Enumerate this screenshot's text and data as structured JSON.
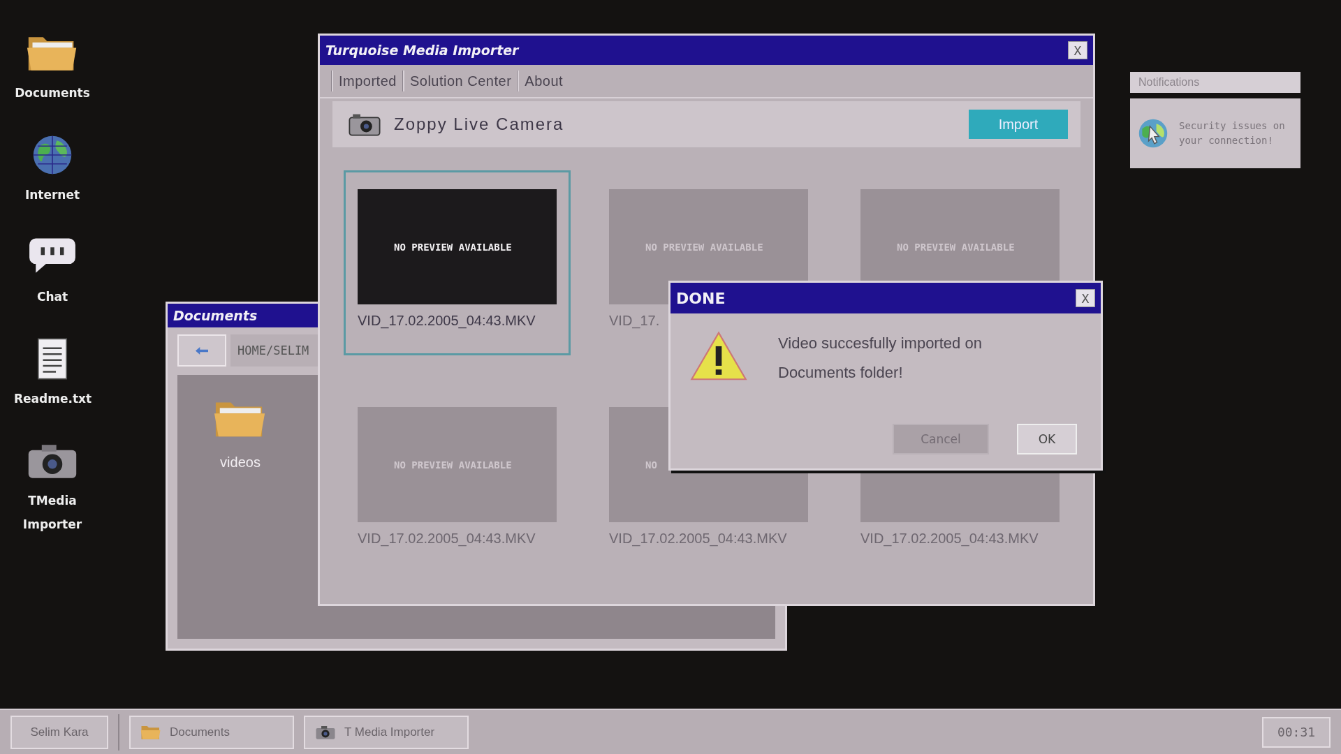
{
  "desktop_icons": [
    {
      "label": "Documents",
      "kind": "folder"
    },
    {
      "label": "Internet",
      "kind": "globe"
    },
    {
      "label": "Chat",
      "kind": "chat"
    },
    {
      "label": "Readme.txt",
      "kind": "document"
    },
    {
      "label": "TMedia Importer",
      "kind": "camera"
    }
  ],
  "documents_window": {
    "title": "Documents",
    "path": "HOME/SELIM",
    "items": [
      {
        "label": "videos",
        "kind": "folder"
      }
    ]
  },
  "main_window": {
    "title": "Turquoise Media Importer",
    "close": "X",
    "menu": [
      "Imported",
      "Solution Center",
      "About"
    ],
    "device": "Zoppy Live Camera",
    "import_button": "Import",
    "files": [
      {
        "preview": "NO PREVIEW AVAILABLE",
        "name": "VID_17.02.2005_04:43.MKV",
        "selected": true
      },
      {
        "preview": "NO PREVIEW AVAILABLE",
        "name": "VID_17.",
        "selected": false
      },
      {
        "preview": "NO PREVIEW AVAILABLE",
        "selected": false
      },
      {
        "preview": "NO PREVIEW AVAILABLE",
        "name": "VID_17.02.2005_04:43.MKV",
        "selected": false
      },
      {
        "preview": "NO",
        "name": "VID_17.02.2005_04:43.MKV",
        "selected": false
      },
      {
        "name": "VID_17.02.2005_04:43.MKV",
        "selected": false
      }
    ]
  },
  "dialog": {
    "title": "DONE",
    "close": "X",
    "message": "Video succesfully imported on Documents folder!",
    "buttons": [
      {
        "label": "Cancel",
        "disabled": true
      },
      {
        "label": "OK",
        "disabled": false
      }
    ]
  },
  "notifications": {
    "title": "Notifications",
    "items": [
      {
        "message": "Security issues on your connection!"
      }
    ]
  },
  "taskbar": {
    "start": "Selim Kara",
    "tasks": [
      {
        "label": "Documents",
        "kind": "folder"
      },
      {
        "label": "T Media Importer",
        "kind": "camera"
      }
    ],
    "clock": "00:31"
  }
}
